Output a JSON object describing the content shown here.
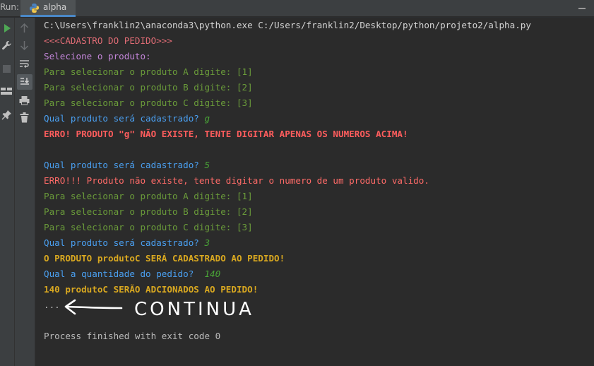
{
  "toolwindow": {
    "run_label": "Run:",
    "tab_label": "alpha"
  },
  "console": {
    "command": "C:\\Users\\franklin2\\anaconda3\\python.exe C:/Users/franklin2/Desktop/python/projeto2/alpha.py",
    "header": "<<<CADASTRO DO PEDIDO>>>",
    "select_prompt": "Selecione o produto:",
    "option_a": "Para selecionar o produto A digite: [1]",
    "option_b": "Para selecionar o produto B digite: [2]",
    "option_c": "Para selecionar o produto C digite: [3]",
    "question_product": "Qual produto será cadastrado? ",
    "input_1": "g",
    "error_1": "ERRO! PRODUTO \"g\" NÃO EXISTE, TENTE DIGITAR APENAS OS NUMEROS ACIMA!",
    "input_2": "5",
    "error_2": "ERRO!!! Produto não existe, tente digitar o numero de um produto valido.",
    "input_3": "3",
    "confirm_product": "O PRODUTO produtoC SERÁ CADASTRADO AO PEDIDO!",
    "question_qty": "Qual a quantidade do pedido?  ",
    "input_qty": "140",
    "confirm_qty": "140 produtoC SERÃO ADCIONADOS AO PEDIDO!",
    "ellipsis": "...",
    "annotation_text": "CONTINUA",
    "exit_message": "Process finished with exit code 0"
  },
  "icons": {
    "left_toolbar": [
      "run-icon",
      "wrench-icon",
      "stop-icon",
      "layout-icon",
      "pin-icon"
    ],
    "right_toolbar": [
      "up-arrow-icon",
      "down-arrow-icon",
      "soft-wrap-icon",
      "scroll-to-end-icon",
      "print-icon",
      "trash-icon"
    ]
  },
  "colors": {
    "console_bg": "#2b2b2b",
    "error_text": "#ff6b68",
    "user_input": "#4aa637",
    "prompt_blue": "#4a9ff0",
    "option_green": "#6a9b3a",
    "success_gold": "#d9a820"
  }
}
